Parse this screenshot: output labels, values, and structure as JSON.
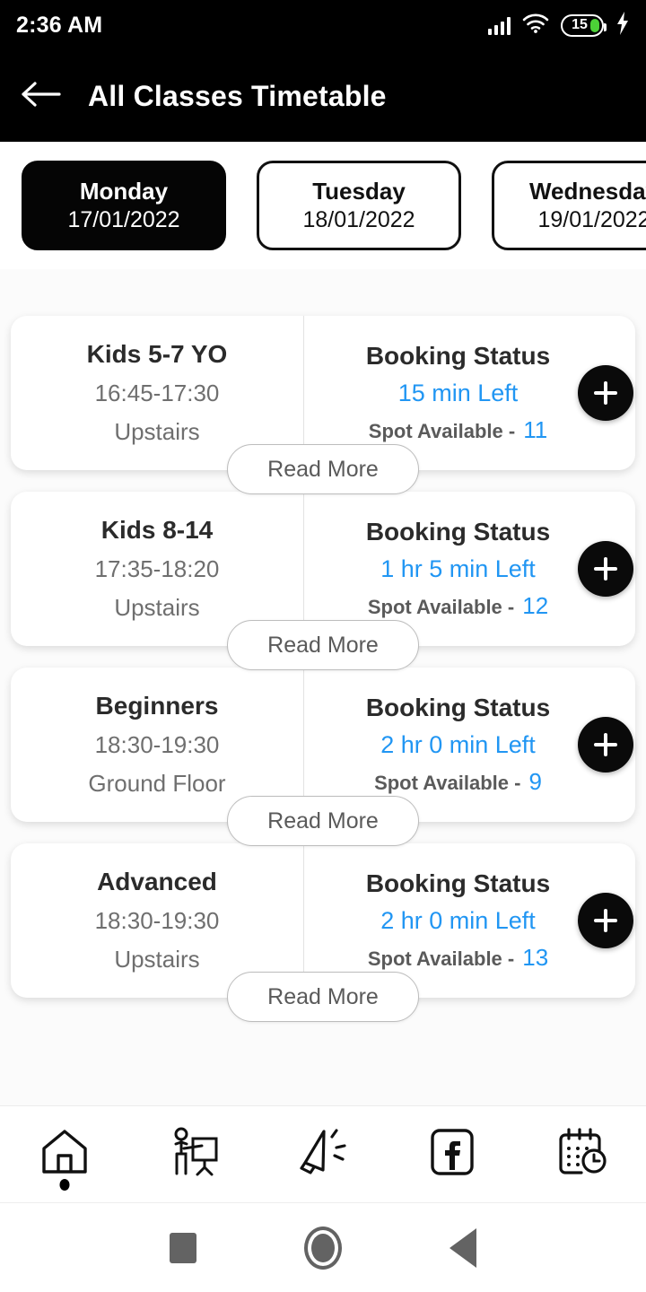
{
  "statusbar": {
    "time": "2:36 AM",
    "battery_level": "15",
    "icons": [
      "signal-icon",
      "wifi-icon",
      "battery-icon",
      "charging-bolt-icon"
    ]
  },
  "appbar": {
    "back_icon": "back-arrow-icon",
    "title": "All Classes Timetable"
  },
  "day_tabs": [
    {
      "day": "Monday",
      "date": "17/01/2022",
      "selected": true
    },
    {
      "day": "Tuesday",
      "date": "18/01/2022",
      "selected": false
    },
    {
      "day": "Wednesday",
      "date": "19/01/2022",
      "selected": false
    }
  ],
  "booking_status_label": "Booking Status",
  "spot_label": "Spot Available -",
  "read_more_label": "Read More",
  "add_icon": "plus-icon",
  "classes": [
    {
      "name": "Kids 5-7 YO",
      "time": "16:45-17:30",
      "location": "Upstairs",
      "booking_title": "Booking Status",
      "time_left": "15 min Left",
      "spot_label": "Spot Available -",
      "spots": "11",
      "read_more": "Read More"
    },
    {
      "name": "Kids 8-14",
      "time": "17:35-18:20",
      "location": "Upstairs",
      "booking_title": "Booking Status",
      "time_left": "1 hr 5 min Left",
      "spot_label": "Spot Available -",
      "spots": "12",
      "read_more": "Read More"
    },
    {
      "name": "Beginners",
      "time": "18:30-19:30",
      "location": "Ground Floor",
      "booking_title": "Booking Status",
      "time_left": "2 hr 0 min Left",
      "spot_label": "Spot Available -",
      "spots": "9",
      "read_more": "Read More"
    },
    {
      "name": "Advanced",
      "time": "18:30-19:30",
      "location": "Upstairs",
      "booking_title": "Booking Status",
      "time_left": "2 hr 0 min Left",
      "spot_label": "Spot Available -",
      "spots": "13",
      "read_more": "Read More"
    }
  ],
  "bottom_nav": [
    {
      "icon": "home-icon",
      "active": true
    },
    {
      "icon": "presenter-icon",
      "active": false
    },
    {
      "icon": "megaphone-icon",
      "active": false
    },
    {
      "icon": "facebook-icon",
      "active": false
    },
    {
      "icon": "calendar-clock-icon",
      "active": false
    }
  ],
  "android_nav": [
    {
      "icon": "recents-square-icon"
    },
    {
      "icon": "home-circle-icon"
    },
    {
      "icon": "back-triangle-icon"
    }
  ],
  "colors": {
    "accent_blue": "#2196f3",
    "header_black": "#000000",
    "battery_green": "#4cd137",
    "muted_text": "#6f6f6f"
  }
}
